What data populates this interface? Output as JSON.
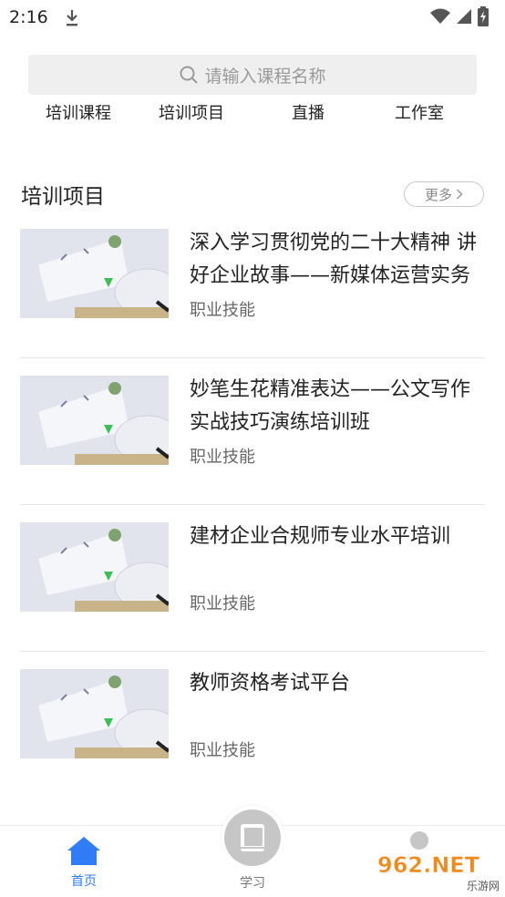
{
  "status_bar": {
    "time": "2:16"
  },
  "search": {
    "placeholder": "请输入课程名称",
    "icon": "search-icon"
  },
  "categories": [
    {
      "label": "培训课程"
    },
    {
      "label": "培训项目"
    },
    {
      "label": "直播"
    },
    {
      "label": "工作室"
    }
  ],
  "section": {
    "title": "培训项目",
    "more_label": "更多"
  },
  "items": [
    {
      "title": "深入学习贯彻党的二十大精神 讲好企业故事——新媒体运营实务",
      "tag": "职业技能"
    },
    {
      "title": "妙笔生花精准表达——公文写作实战技巧演练培训班",
      "tag": "职业技能"
    },
    {
      "title": "建材企业合规师专业水平培训",
      "tag": "职业技能"
    },
    {
      "title": "教师资格考试平台",
      "tag": "职业技能"
    }
  ],
  "bottom_nav": {
    "home_label": "首页",
    "study_label": "学习",
    "accent": "#2f7cf6"
  },
  "watermark": {
    "big": "962.NET",
    "small": "乐游网"
  }
}
